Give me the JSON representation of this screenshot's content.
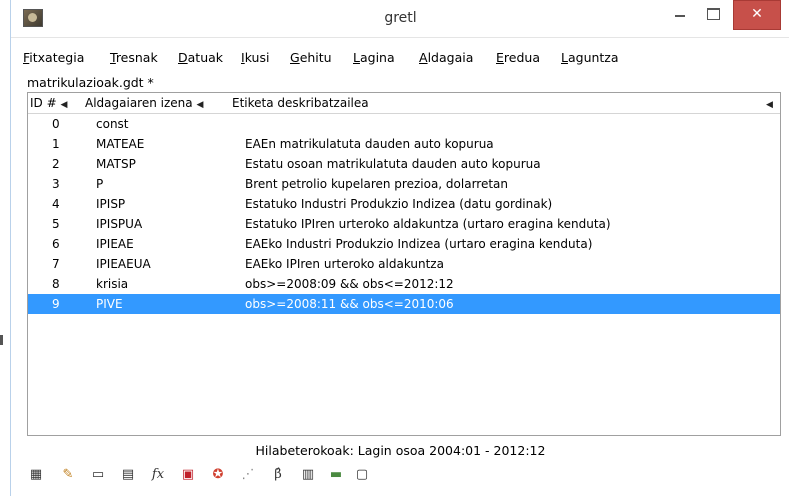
{
  "window": {
    "title": "gretl",
    "min_label": "",
    "close_label": "✕"
  },
  "menu": [
    {
      "label": "Fitxategia"
    },
    {
      "label": "Tresnak"
    },
    {
      "label": "Datuak"
    },
    {
      "label": "Ikusi"
    },
    {
      "label": "Gehitu"
    },
    {
      "label": "Lagina"
    },
    {
      "label": "Aldagaia"
    },
    {
      "label": "Eredua"
    },
    {
      "label": "Laguntza"
    }
  ],
  "file": {
    "name": "matrikulazioak.gdt *"
  },
  "table": {
    "headers": {
      "id": "ID #",
      "name": "Aldagaiaren izena",
      "label": "Etiketa deskribatzailea"
    },
    "rows": [
      {
        "id": "0",
        "name": "const",
        "label": ""
      },
      {
        "id": "1",
        "name": "MATEAE",
        "label": "EAEn matrikulatuta dauden auto kopurua"
      },
      {
        "id": "2",
        "name": "MATSP",
        "label": "Estatu osoan matrikulatuta dauden auto kopurua"
      },
      {
        "id": "3",
        "name": "P",
        "label": "Brent petrolio kupelaren prezioa, dolarretan"
      },
      {
        "id": "4",
        "name": "IPISP",
        "label": "Estatuko Industri Produkzio Indizea (datu gordinak)"
      },
      {
        "id": "5",
        "name": "IPISPUA",
        "label": "Estatuko IPIren urteroko aldakuntza (urtaro eragina kenduta)"
      },
      {
        "id": "6",
        "name": "IPIEAE",
        "label": "EAEko Industri Produkzio Indizea (urtaro eragina kenduta)"
      },
      {
        "id": "7",
        "name": "IPIEAEUA",
        "label": "EAEko IPIren urteroko aldakuntza"
      },
      {
        "id": "8",
        "name": "krisia",
        "label": "obs>=2008:09 && obs<=2012:12"
      },
      {
        "id": "9",
        "name": "PIVE",
        "label": "obs>=2008:11 && obs<=2010:06"
      }
    ],
    "selected_row": "9"
  },
  "status": {
    "text": "Hilabeterokoak: Lagin osoa 2004:01 - 2012:12"
  },
  "toolbar_icons": [
    "calculator-icon",
    "edit-script-icon",
    "terminal-icon",
    "session-icon",
    "function-icon",
    "pdf-icon",
    "help-icon",
    "scatter-plot-icon",
    "beta-hat-icon",
    "bundle-icon",
    "folder-icon",
    "windows-icon"
  ],
  "colors": {
    "selection": "#3399ff",
    "close_button": "#c7504a"
  }
}
